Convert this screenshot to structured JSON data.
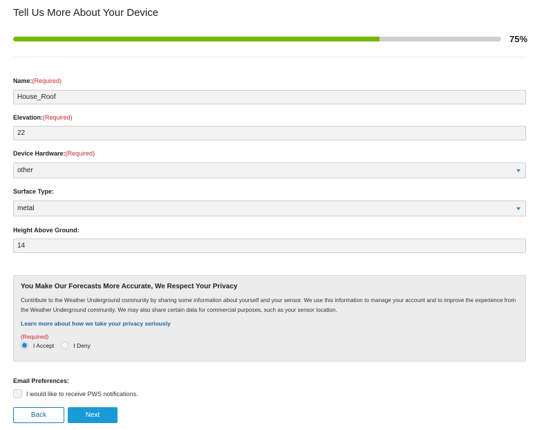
{
  "page": {
    "title": "Tell Us More About Your Device"
  },
  "progress": {
    "percent": 75,
    "label": "75%",
    "fill_color": "#77b800"
  },
  "form": {
    "required_marker": "(Required)",
    "fields": [
      {
        "label": "Name:",
        "required": true,
        "type": "text",
        "value": "House_Roof"
      },
      {
        "label": "Elevation:",
        "required": true,
        "type": "text",
        "value": "22"
      },
      {
        "label": "Device Hardware:",
        "required": true,
        "type": "select",
        "value": "other"
      },
      {
        "label": "Surface Type:",
        "required": false,
        "type": "select",
        "value": "metal"
      },
      {
        "label": "Height Above Ground:",
        "required": false,
        "type": "text",
        "value": "14"
      }
    ]
  },
  "privacy": {
    "title": "You Make Our Forecasts More Accurate, We Respect Your Privacy",
    "body": "Contribute to the Weather Underground community by sharing some information about yourself and your sensor. We use this information to manage your account and to improve the experience from the Weather Underground community. We may also share certain data for commercial purposes, such as your sensor location.",
    "link": "Learn more about how we take your privacy seriously",
    "required": "(Required)",
    "options": [
      {
        "label": "I Accept",
        "selected": true
      },
      {
        "label": "I Deny",
        "selected": false
      }
    ]
  },
  "email": {
    "label": "Email Preferences:",
    "checkbox_label": "I would like to receive PWS notifications.",
    "checked": false
  },
  "buttons": {
    "back": "Back",
    "next": "Next"
  },
  "colors": {
    "accent": "#1a9ad6",
    "link": "#1a6a9c",
    "required": "#c8262c",
    "progress": "#77b800"
  }
}
